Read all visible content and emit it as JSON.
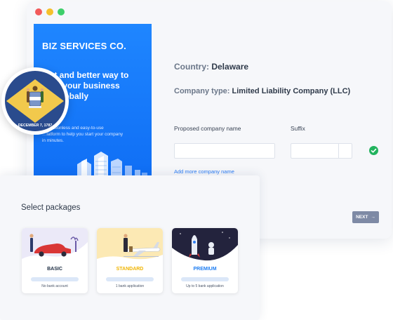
{
  "window": {
    "brand": "BIZ SERVICES CO.",
    "headline": "Fast and better way to start your business from the states globally",
    "headline_visible": "fast and better way to\nstart your business\ntes globally",
    "subtext": "Fast, frictionless and easy-to-use platform to help you start your company in minutes.",
    "subtext_visible": "…, frictionless and easy-to-use\n…latform to help you start your company\nin minutes."
  },
  "form": {
    "country_label": "Country:",
    "country_value": "Delaware",
    "company_type_label": "Company type:",
    "company_type_value": "Limited Liability Company (LLC)",
    "proposed_name_label": "Proposed company name",
    "suffix_label": "Suffix",
    "add_more_link": "Add more company name",
    "next_button": "NEXT",
    "next_arrow": "→"
  },
  "flag": {
    "state": "Delaware",
    "motto_text": "DECEMBER 7, 1787",
    "colors": {
      "field": "#2a4b8d",
      "diamond": "#f2c94c"
    }
  },
  "packages": {
    "title": "Select packages",
    "items": [
      {
        "name": "BASIC",
        "desc": "No bank account",
        "color": "#1a2a40",
        "art_bg": "#ebe9f8"
      },
      {
        "name": "STANDARD",
        "desc": "1 bank application",
        "color": "#f0b400",
        "art_bg": "#fce9b4"
      },
      {
        "name": "PREMIUM",
        "desc": "Up to 5 bank application",
        "color": "#1f7ef2",
        "art_bg": "#23233d"
      }
    ]
  },
  "colors": {
    "accent_blue": "#1f86ff",
    "success_green": "#22b35e",
    "button_gray": "#7e8aa5"
  }
}
